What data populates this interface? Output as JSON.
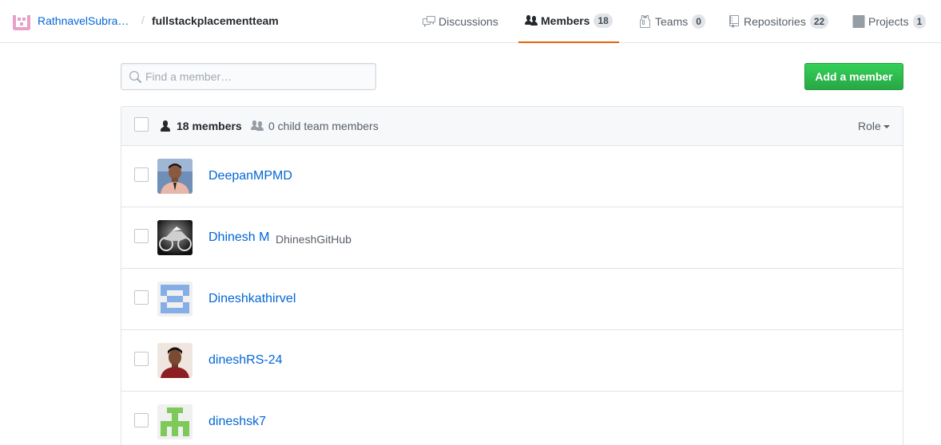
{
  "header": {
    "org_name": "RathnavelSubra…",
    "separator": "/",
    "team_name": "fullstackplacementteam",
    "tabs": [
      {
        "label": "Discussions",
        "count": null,
        "icon": "comment-discussion-icon",
        "selected": false
      },
      {
        "label": "Members",
        "count": "18",
        "icon": "people-icon",
        "selected": true
      },
      {
        "label": "Teams",
        "count": "0",
        "icon": "jersey-icon",
        "selected": false
      },
      {
        "label": "Repositories",
        "count": "22",
        "icon": "repo-icon",
        "selected": false
      },
      {
        "label": "Projects",
        "count": "1",
        "icon": "project-icon",
        "selected": false
      }
    ],
    "accent_color": "#e36209"
  },
  "toolbar": {
    "search_placeholder": "Find a member…",
    "add_button_label": "Add a member",
    "add_button_color": "#28a745"
  },
  "table": {
    "members_label": "18 members",
    "child_members_label": "0 child team members",
    "role_label": "Role",
    "rows": [
      {
        "name": "DeepanMPMD",
        "login": "",
        "avatar": "photo"
      },
      {
        "name": "Dhinesh M",
        "login": "DhineshGitHub",
        "avatar": "motorbike"
      },
      {
        "name": "Dineshkathirvel",
        "login": "",
        "avatar": "identicon-blue"
      },
      {
        "name": "dineshRS-24",
        "login": "",
        "avatar": "photo"
      },
      {
        "name": "dineshsk7",
        "login": "",
        "avatar": "identicon-green"
      }
    ]
  }
}
